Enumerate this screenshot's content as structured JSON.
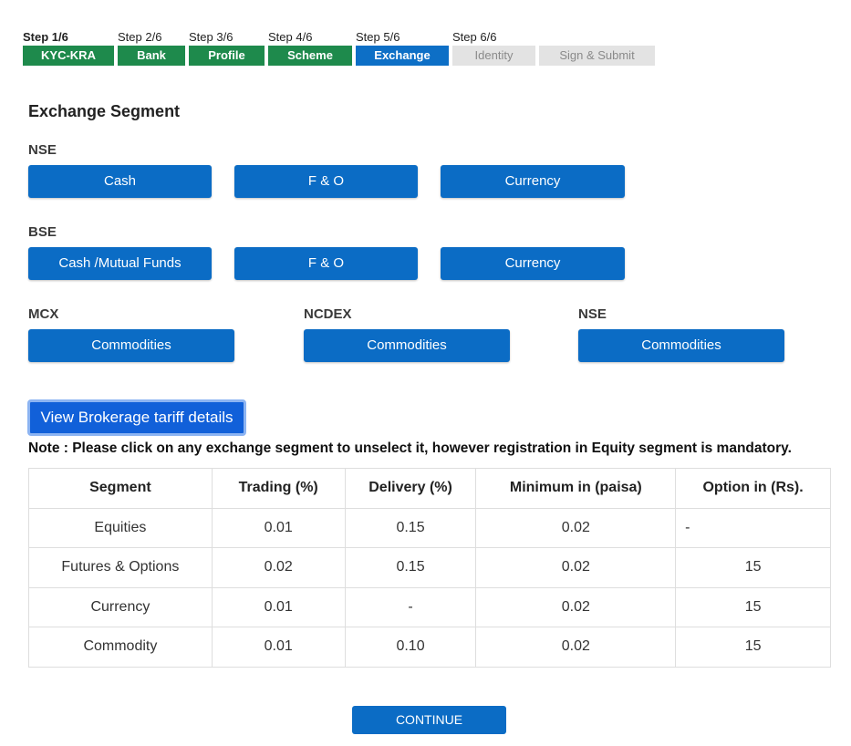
{
  "steps": [
    {
      "label": "Step 1/6",
      "name": "KYC-KRA",
      "state": "done"
    },
    {
      "label": "Step 2/6",
      "name": "Bank",
      "state": "done"
    },
    {
      "label": "Step 3/6",
      "name": "Profile",
      "state": "done"
    },
    {
      "label": "Step 4/6",
      "name": "Scheme",
      "state": "done"
    },
    {
      "label": "Step 5/6",
      "name": "Exchange",
      "state": "current"
    },
    {
      "label": "Step 6/6",
      "name": "Identity",
      "state": "pending"
    },
    {
      "label": "",
      "name": "Sign & Submit",
      "state": "pending"
    }
  ],
  "heading": "Exchange Segment",
  "nse": {
    "label": "NSE",
    "buttons": [
      "Cash",
      "F & O",
      "Currency"
    ]
  },
  "bse": {
    "label": "BSE",
    "buttons": [
      "Cash /Mutual Funds",
      "F & O",
      "Currency"
    ]
  },
  "commodities": [
    {
      "label": "MCX",
      "button": "Commodities"
    },
    {
      "label": "NCDEX",
      "button": "Commodities"
    },
    {
      "label": "NSE",
      "button": "Commodities"
    }
  ],
  "tariff_button": "View Brokerage tariff details",
  "note": "Note : Please click on any exchange segment to unselect it, however registration in Equity segment is mandatory.",
  "table": {
    "headers": [
      "Segment",
      "Trading (%)",
      "Delivery (%)",
      "Minimum in (paisa)",
      "Option in (Rs)."
    ],
    "rows": [
      [
        "Equities",
        "0.01",
        "0.15",
        "0.02",
        "-"
      ],
      [
        "Futures & Options",
        "0.02",
        "0.15",
        "0.02",
        "15"
      ],
      [
        "Currency",
        "0.01",
        "-",
        "0.02",
        "15"
      ],
      [
        "Commodity",
        "0.01",
        "0.10",
        "0.02",
        "15"
      ]
    ]
  },
  "continue_label": "CONTINUE",
  "colors": {
    "done": "#1e8a4c",
    "current": "#0d6fc6",
    "pending": "#e3e3e3",
    "button": "#0b6cc5"
  }
}
